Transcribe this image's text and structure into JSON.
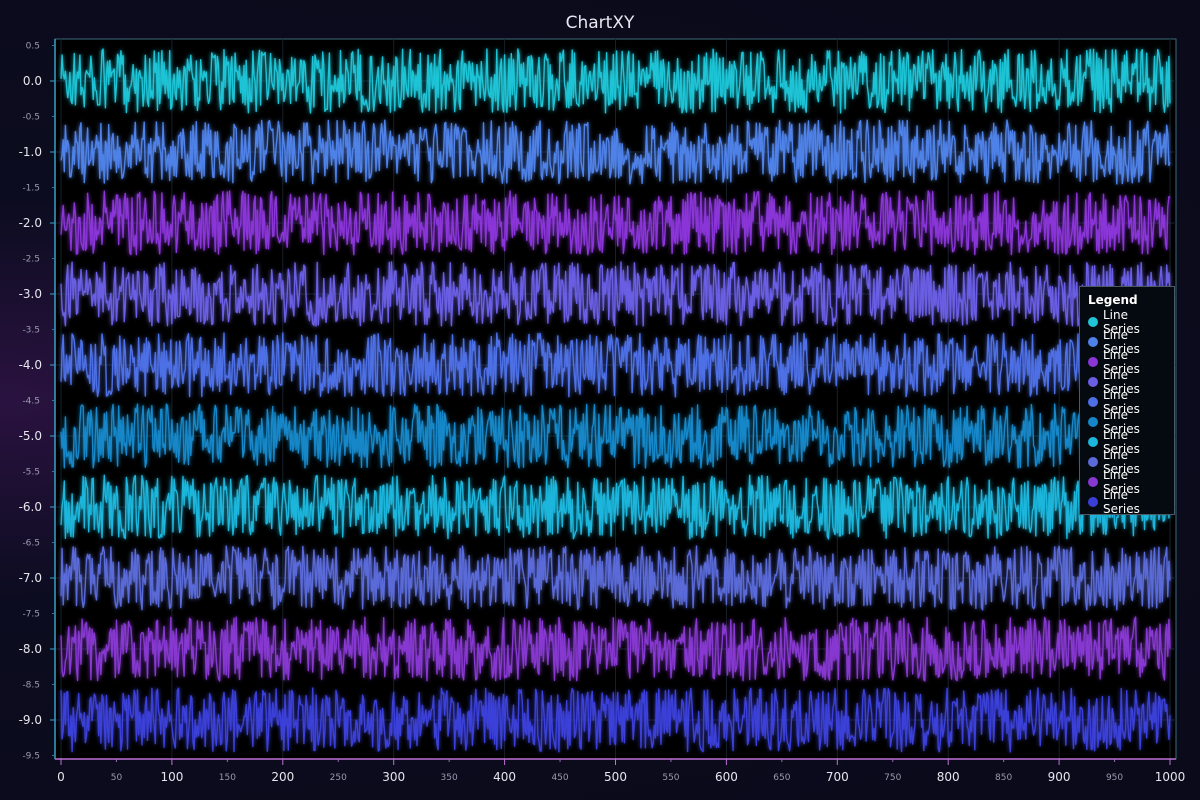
{
  "chart_data": {
    "type": "line",
    "title": "ChartXY",
    "xlabel": "",
    "ylabel": "",
    "xlim": [
      0,
      1000
    ],
    "ylim": [
      -9.6,
      0.5
    ],
    "grid": true,
    "legend_position": "right",
    "legend_title": "Legend",
    "x_major_ticks": [
      0,
      100,
      200,
      300,
      400,
      500,
      600,
      700,
      800,
      900,
      1000
    ],
    "x_minor_ticks": [
      50,
      150,
      250,
      350,
      450,
      550,
      650,
      750,
      850,
      950
    ],
    "y_major_ticks": [
      0.0,
      -1.0,
      -2.0,
      -3.0,
      -4.0,
      -5.0,
      -6.0,
      -7.0,
      -8.0,
      -9.0
    ],
    "y_minor_ticks": [
      0.5,
      -0.5,
      -1.5,
      -2.5,
      -3.5,
      -4.5,
      -5.5,
      -6.5,
      -7.5,
      -8.5,
      -9.5
    ],
    "series_note_points": 1000,
    "series": [
      {
        "name": "Line Series",
        "baseline": 0.0,
        "amplitude": 0.45,
        "color": "#1fc4d6"
      },
      {
        "name": "Line Series",
        "baseline": -1.0,
        "amplitude": 0.45,
        "color": "#4f82e8"
      },
      {
        "name": "Line Series",
        "baseline": -2.0,
        "amplitude": 0.45,
        "color": "#8a35d8"
      },
      {
        "name": "Line Series",
        "baseline": -3.0,
        "amplitude": 0.45,
        "color": "#6a5ee4"
      },
      {
        "name": "Line Series",
        "baseline": -4.0,
        "amplitude": 0.45,
        "color": "#4e6fe6"
      },
      {
        "name": "Line Series",
        "baseline": -5.0,
        "amplitude": 0.45,
        "color": "#1587c8"
      },
      {
        "name": "Line Series",
        "baseline": -6.0,
        "amplitude": 0.45,
        "color": "#1cb6dc"
      },
      {
        "name": "Line Series",
        "baseline": -7.0,
        "amplitude": 0.45,
        "color": "#5a6ad8"
      },
      {
        "name": "Line Series",
        "baseline": -8.0,
        "amplitude": 0.45,
        "color": "#8638d0"
      },
      {
        "name": "Line Series",
        "baseline": -9.0,
        "amplitude": 0.45,
        "color": "#3b3fd8"
      }
    ]
  }
}
